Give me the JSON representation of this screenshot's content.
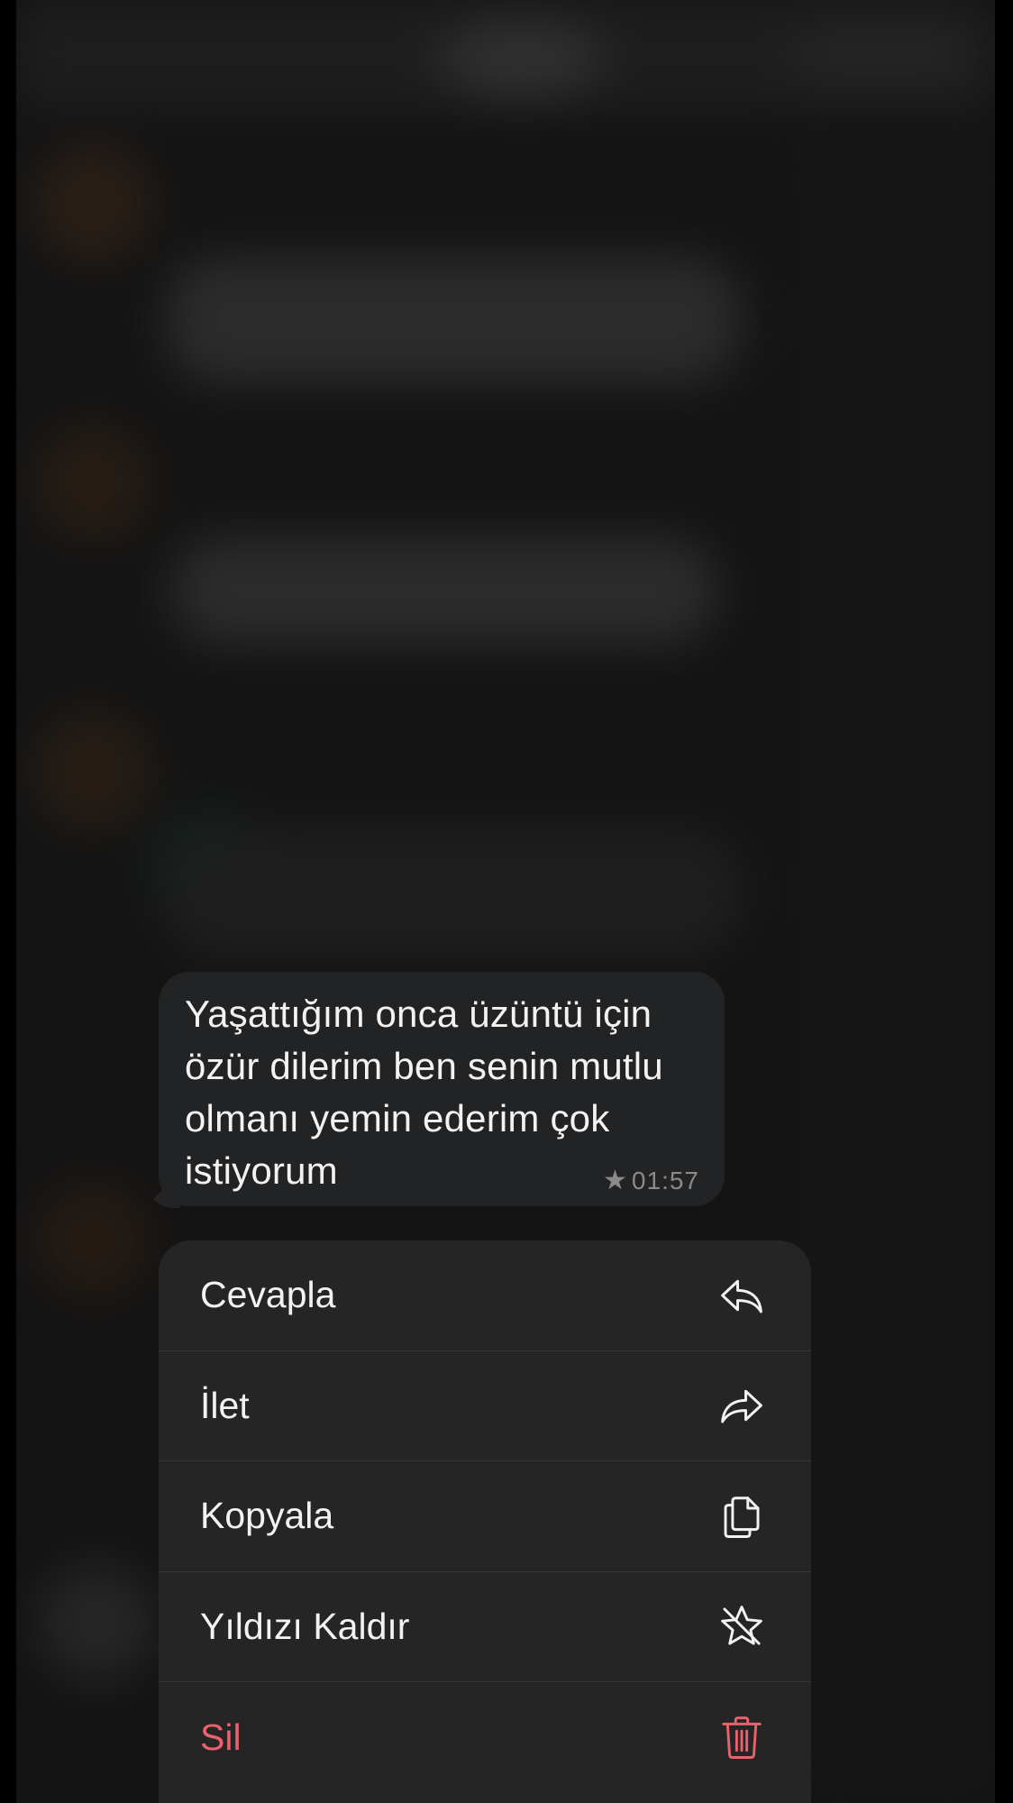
{
  "message": {
    "text": "Yaşattığım onca üzüntü için özür dilerim ben senin mutlu olmanı yemin ederim çok istiyorum",
    "lines": [
      "Yaşattığım onca üzüntü için",
      "özür dilerim ben senin mutlu",
      "olmanı yemin ederim çok",
      "istiyorum"
    ],
    "time": "01:57",
    "starred": true,
    "star_glyph": "★"
  },
  "context_menu": {
    "items": [
      {
        "label": "Cevapla",
        "icon": "reply-icon"
      },
      {
        "label": "İlet",
        "icon": "forward-icon"
      },
      {
        "label": "Kopyala",
        "icon": "copy-icon"
      },
      {
        "label": "Yıldızı Kaldır",
        "icon": "unstar-icon"
      },
      {
        "label": "Sil",
        "icon": "trash-icon",
        "destructive": true
      }
    ]
  },
  "colors": {
    "background": "#141414",
    "bubble": "#222324",
    "menu": "#252526",
    "text": "#f2f2f2",
    "meta": "#8a8a8a",
    "destructive": "#e8616b"
  }
}
